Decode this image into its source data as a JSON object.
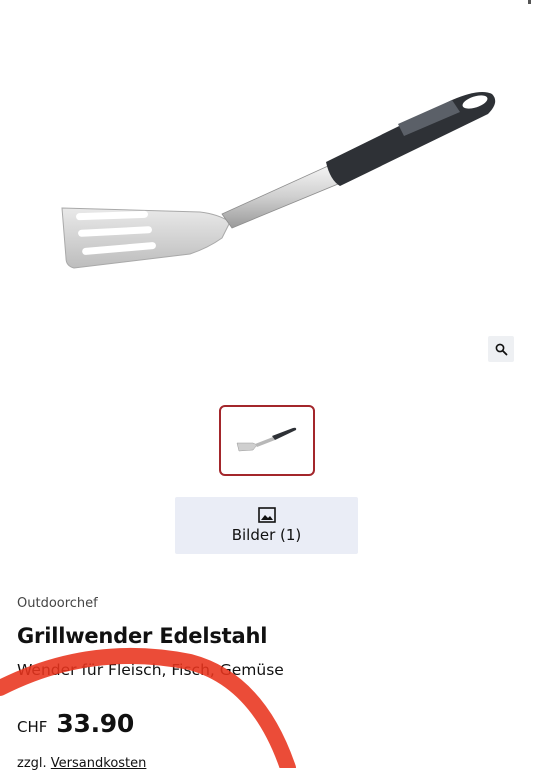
{
  "gallery": {
    "zoom_icon": "magnifier-icon",
    "image_icon": "image-icon",
    "button_label": "Bilder (1)"
  },
  "product": {
    "brand": "Outdoorchef",
    "title": "Grillwender Edelstahl",
    "subtitle": "Wender für Fleisch, Fisch, Gemüse",
    "currency": "CHF",
    "price": "33.90",
    "shipping_prefix": "zzgl.",
    "shipping_link": "Versandkosten"
  },
  "colors": {
    "thumb_border": "#a3262b",
    "gallery_button_bg": "#eaedf6",
    "annotation_stroke": "#e8331c"
  }
}
